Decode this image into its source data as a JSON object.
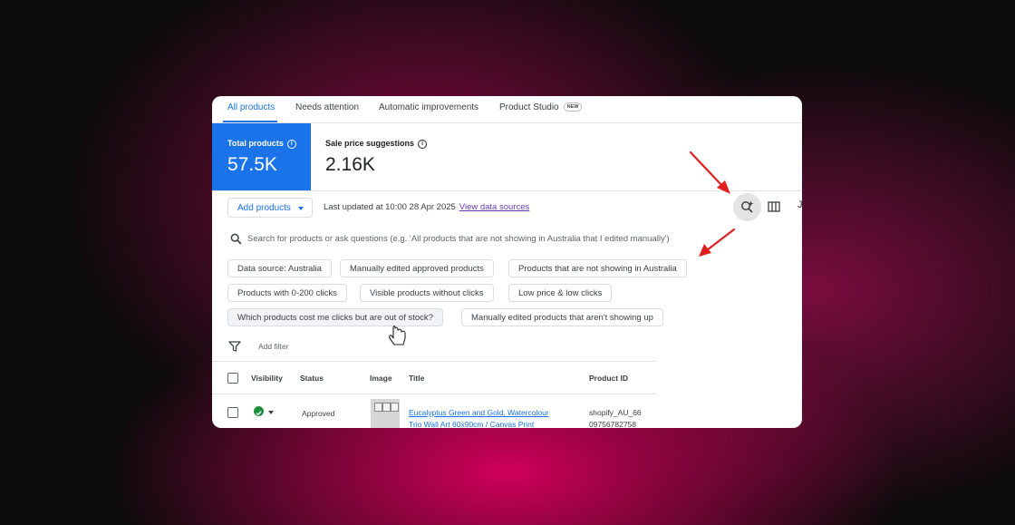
{
  "colors": {
    "accent": "#1a73e8",
    "annotation_arrow": "#e02020",
    "approved": "#1e8e3e"
  },
  "tabs": [
    {
      "label": "All products",
      "active": true
    },
    {
      "label": "Needs attention"
    },
    {
      "label": "Automatic improvements"
    },
    {
      "label": "Product Studio",
      "badge": "NEW"
    }
  ],
  "stats": {
    "total": {
      "label": "Total products",
      "value": "57.5K"
    },
    "sale": {
      "label": "Sale price suggestions",
      "value": "2.16K"
    }
  },
  "toolbar": {
    "add_products": "Add products",
    "last_updated": "Last updated at 10:00 28 Apr 2025",
    "view_data_sources": "View data sources",
    "edge_char": "J"
  },
  "search": {
    "placeholder": "Search for products or ask questions (e.g. 'All products that are not showing in Australia that I edited manually')"
  },
  "suggestions": [
    "Data source: Australia",
    "Manually edited approved products",
    "Products that are not showing in Australia",
    "Products with 0-200 clicks",
    "Visible products without clicks",
    "Low price & low clicks",
    "Which products cost me clicks but are out of stock?",
    "Manually edited products that aren't showing up"
  ],
  "filter": {
    "add_filter": "Add filter"
  },
  "table": {
    "headers": [
      "Visibility",
      "Status",
      "Image",
      "Title",
      "Product ID"
    ],
    "rows": [
      {
        "status": "Approved",
        "title": "Eucalyptus Green and Gold, Watercolour Trio Wall Art 60x90cm / Canvas Print",
        "product_id": "shopify_AU_6609756782758"
      }
    ]
  }
}
